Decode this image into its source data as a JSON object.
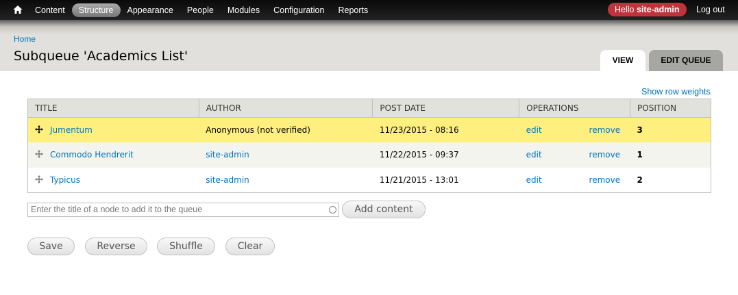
{
  "toolbar": {
    "home_icon": "home-icon",
    "nav": [
      {
        "label": "Content"
      },
      {
        "label": "Structure",
        "active": true
      },
      {
        "label": "Appearance"
      },
      {
        "label": "People"
      },
      {
        "label": "Modules"
      },
      {
        "label": "Configuration"
      },
      {
        "label": "Reports"
      }
    ],
    "greeting": "Hello",
    "username": "site-admin",
    "logout": "Log out",
    "user_badge_color": "#c1333b"
  },
  "header": {
    "breadcrumb": "Home",
    "title": "Subqueue 'Academics List'",
    "tabs": [
      {
        "label": "VIEW",
        "active": true
      },
      {
        "label": "EDIT QUEUE"
      }
    ]
  },
  "main": {
    "show_row_weights": "Show row weights",
    "columns": [
      "TITLE",
      "AUTHOR",
      "POST DATE",
      "OPERATIONS",
      "POSITION"
    ],
    "rows": [
      {
        "title": "Jumentum",
        "author": "Anonymous (not verified)",
        "date": "11/23/2015 - 08:16",
        "edit": "edit",
        "remove": "remove",
        "position": "3"
      },
      {
        "title": "Commodo Hendrerit",
        "author": "site-admin",
        "date": "11/22/2015 - 09:37",
        "edit": "edit",
        "remove": "remove",
        "position": "1"
      },
      {
        "title": "Typicus",
        "author": "site-admin",
        "date": "11/21/2015 - 13:01",
        "edit": "edit",
        "remove": "remove",
        "position": "2"
      }
    ],
    "add_placeholder": "Enter the title of a node to add it to the queue",
    "add_button": "Add content",
    "actions": {
      "save": "Save",
      "reverse": "Reverse",
      "shuffle": "Shuffle",
      "clear": "Clear"
    },
    "link_color": "#0074bd",
    "highlight_color": "#ffef7f"
  }
}
